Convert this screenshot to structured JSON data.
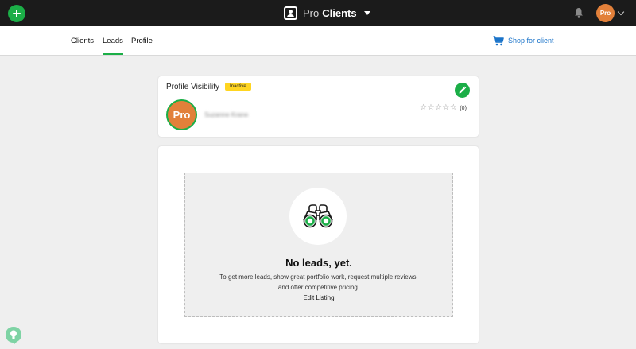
{
  "topbar": {
    "add_icon": "plus-icon",
    "brand_icon": "user-box-icon",
    "brand_prefix": "Pro",
    "brand_name": "Clients",
    "bell_icon": "bell-icon",
    "avatar_text": "Pro",
    "avatar_caret_icon": "chevron-down-icon"
  },
  "nav": {
    "tabs": [
      {
        "label": "Clients",
        "active": false
      },
      {
        "label": "Leads",
        "active": true
      },
      {
        "label": "Profile",
        "active": false
      }
    ],
    "shop_icon": "cart-icon",
    "shop_label": "Shop for client"
  },
  "profile_card": {
    "title": "Profile Visibility",
    "status_badge": "Inactive",
    "edit_icon": "pencil-icon",
    "avatar_text": "Pro",
    "pro_name": "Suzanne Krane",
    "rating": 0,
    "max_rating": 5,
    "review_count": "(0)"
  },
  "leads_card": {
    "empty_icon": "binoculars-icon",
    "title": "No leads, yet.",
    "description_lines": [
      "To get more leads, show great portfolio work, request multiple reviews,",
      "and offer competitive pricing."
    ],
    "edit_link": "Edit Listing"
  },
  "help": {
    "icon": "lightbulb-chat-icon"
  },
  "colors": {
    "topbar_bg": "#1b1b1b",
    "accent_green": "#1bae47",
    "avatar_orange": "#e2803a",
    "badge_yellow": "#ffd520",
    "link_blue": "#1a73c9",
    "page_bg": "#efefef"
  }
}
